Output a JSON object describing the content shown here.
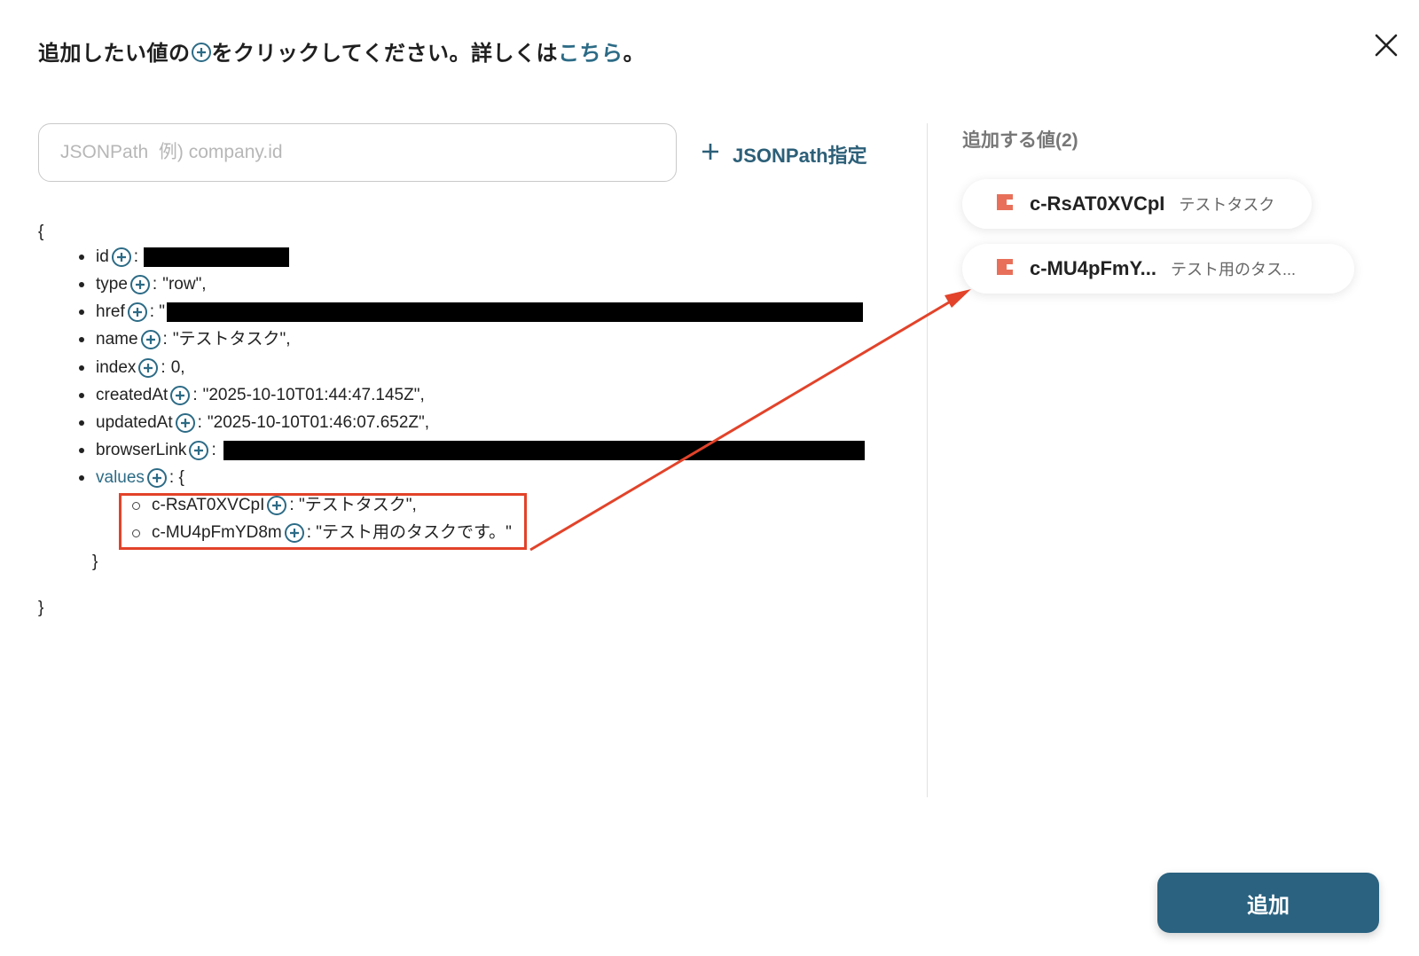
{
  "header": {
    "prefix": "追加したい値の",
    "suffix": "をクリックしてください。詳しくは",
    "link": "こちら",
    "end": "。"
  },
  "search": {
    "placeholder": "JSONPath  例) company.id",
    "value": ""
  },
  "jsonpath_button": {
    "label": "JSONPath指定"
  },
  "selected": {
    "title": "追加する値(2)",
    "items": [
      {
        "key": "c-RsAT0XVCpI",
        "value": "テストタスク"
      },
      {
        "key": "c-MU4pFmY...",
        "value": "テスト用のタス..."
      }
    ]
  },
  "tree": {
    "open": "{",
    "fields": [
      {
        "key": "id",
        "sep": ":"
      },
      {
        "key": "type",
        "sep": ":",
        "value": "\"row\","
      },
      {
        "key": "href",
        "sep": ": \""
      },
      {
        "key": "name",
        "sep": ":",
        "value": "\"テストタスク\","
      },
      {
        "key": "index",
        "sep": ":",
        "value": "0,"
      },
      {
        "key": "createdAt",
        "sep": ":",
        "value": "\"2025-10-10T01:44:47.145Z\","
      },
      {
        "key": "updatedAt",
        "sep": ":",
        "value": "\"2025-10-10T01:46:07.652Z\","
      },
      {
        "key": "browserLink",
        "sep": ":"
      },
      {
        "key": "values",
        "sep": ": {"
      }
    ],
    "values_fields": [
      {
        "key": "c-RsAT0XVCpI",
        "value": ": \"テストタスク\","
      },
      {
        "key": "c-MU4pFmYD8m",
        "value": ": \"テスト用のタスクです。\""
      }
    ],
    "inner_close": "}",
    "close": "}"
  },
  "add_button": {
    "label": "追加"
  },
  "colors": {
    "accent": "#2c6b86",
    "button": "#2a6280",
    "annotation": "#e2432a",
    "chip_icon": "#e8705a"
  }
}
